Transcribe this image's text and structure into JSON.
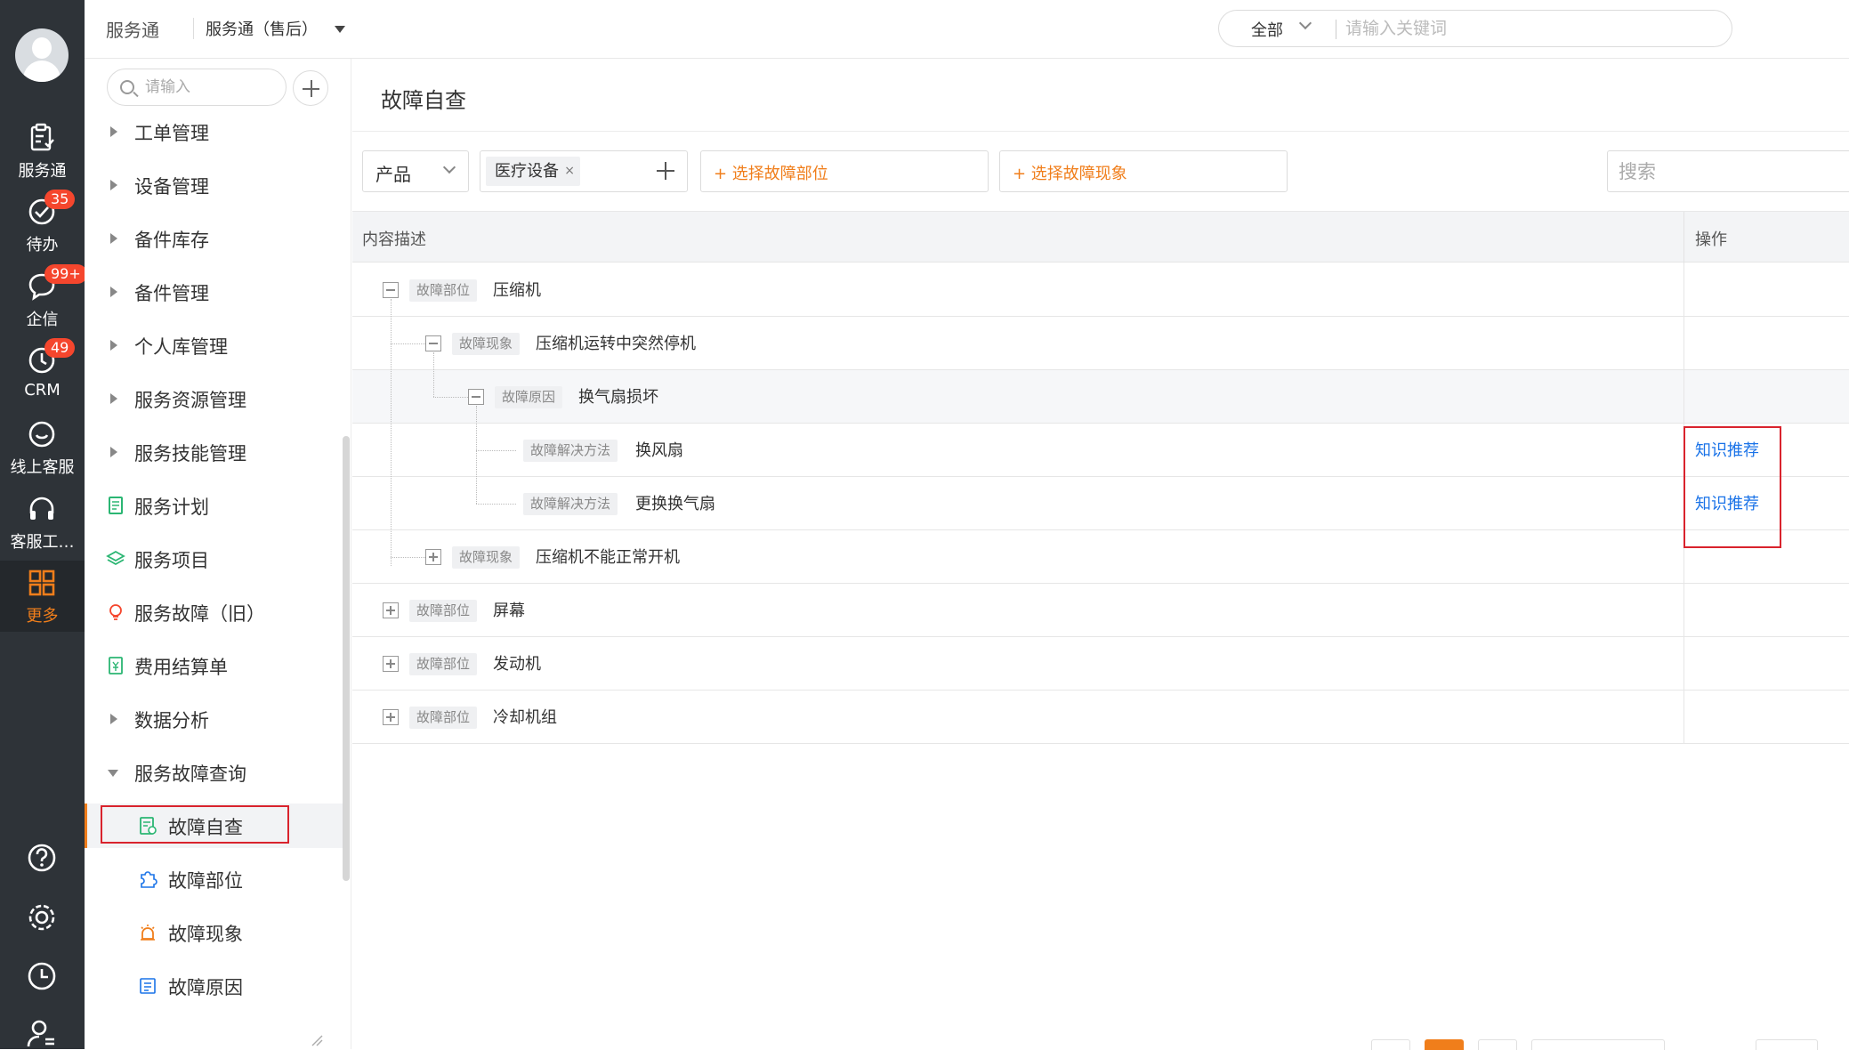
{
  "rail": {
    "items": [
      {
        "label": "服务通",
        "icon": "service-icon"
      },
      {
        "label": "待办",
        "icon": "todo-check-icon",
        "badge": "35"
      },
      {
        "label": "企信",
        "icon": "chat-bubble-icon",
        "badge": "99+"
      },
      {
        "label": "CRM",
        "icon": "clock-icon",
        "badge": "49"
      },
      {
        "label": "线上客服",
        "icon": "smile-icon"
      },
      {
        "label": "客服工…",
        "icon": "headset-icon"
      },
      {
        "label": "更多",
        "icon": "grid-icon"
      }
    ],
    "bottom": [
      "help-icon",
      "settings-icon",
      "history-icon",
      "user-settings-icon"
    ]
  },
  "header": {
    "app_name": "服务通",
    "context": "服务通（售后）",
    "search_scope": "全部",
    "search_placeholder": "请输入关键词"
  },
  "sidebar": {
    "search_placeholder": "请输入",
    "items": [
      {
        "label": "工单管理",
        "type": "group"
      },
      {
        "label": "设备管理",
        "type": "group"
      },
      {
        "label": "备件库存",
        "type": "group"
      },
      {
        "label": "备件管理",
        "type": "group"
      },
      {
        "label": "个人库管理",
        "type": "group"
      },
      {
        "label": "服务资源管理",
        "type": "group"
      },
      {
        "label": "服务技能管理",
        "type": "group"
      },
      {
        "label": "服务计划",
        "type": "page"
      },
      {
        "label": "服务项目",
        "type": "page"
      },
      {
        "label": "服务故障（旧）",
        "type": "page"
      },
      {
        "label": "费用结算单",
        "type": "page"
      },
      {
        "label": "数据分析",
        "type": "group"
      },
      {
        "label": "服务故障查询",
        "type": "group-open"
      },
      {
        "label": "故障自查",
        "type": "sub",
        "current": true
      },
      {
        "label": "故障部位",
        "type": "sub"
      },
      {
        "label": "故障现象",
        "type": "sub"
      },
      {
        "label": "故障原因",
        "type": "sub"
      }
    ]
  },
  "main": {
    "title": "故障自查",
    "filter": {
      "product_label": "产品",
      "tag": "医疗设备",
      "tag_close": "×",
      "select_position": "+ 选择故障部位",
      "select_phenomenon": "+ 选择故障现象",
      "search_placeholder": "搜索"
    },
    "table": {
      "col_content": "内容描述",
      "col_action": "操作",
      "rows": [
        {
          "kind": "故障部位",
          "text": "压缩机",
          "toggle": "minus",
          "action": ""
        },
        {
          "kind": "故障现象",
          "text": "压缩机运转中突然停机",
          "toggle": "minus",
          "action": ""
        },
        {
          "kind": "故障原因",
          "text": "换气扇损坏",
          "toggle": "minus",
          "action": ""
        },
        {
          "kind": "故障解决方法",
          "text": "换风扇",
          "toggle": "",
          "action": "知识推荐"
        },
        {
          "kind": "故障解决方法",
          "text": "更换换气扇",
          "toggle": "",
          "action": "知识推荐"
        },
        {
          "kind": "故障现象",
          "text": "压缩机不能正常开机",
          "toggle": "plus",
          "action": ""
        },
        {
          "kind": "故障部位",
          "text": "屏幕",
          "toggle": "plus",
          "action": ""
        },
        {
          "kind": "故障部位",
          "text": "发动机",
          "toggle": "plus",
          "action": ""
        },
        {
          "kind": "故障部位",
          "text": "冷却机组",
          "toggle": "plus",
          "action": ""
        }
      ]
    }
  },
  "colors": {
    "accent": "#f07e1b",
    "rail_bg": "#2e3338",
    "link": "#1a73e8",
    "badge": "#f5462d",
    "annotation": "#d9232d"
  }
}
